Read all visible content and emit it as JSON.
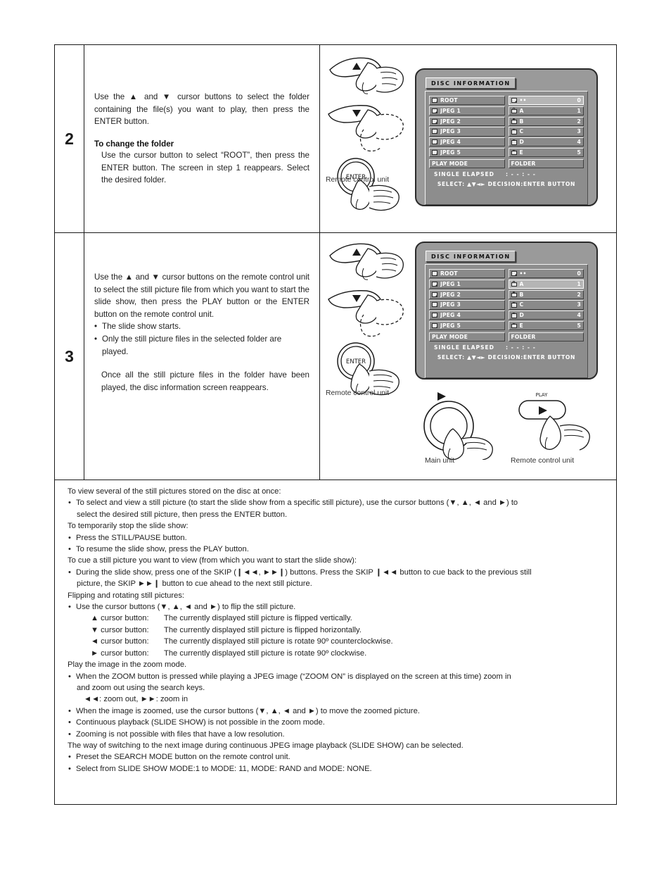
{
  "steps": [
    {
      "number": "2",
      "paragraphs": [
        "Use the ▲ and ▼ cursor buttons to select the folder containing the file(s) you want to play, then press the ENTER button."
      ],
      "subhead": "To change the folder",
      "subtext": "Use the cursor button to select “ROOT”, then press the ENTER button. The screen in step 1 reappears. Select the desired folder.",
      "caption_remote": "Remote control unit"
    },
    {
      "number": "3",
      "paragraphs": [
        "Use the ▲ and ▼ cursor buttons on the remote control unit to select the still picture file from which you want to start the slide show, then press the PLAY button or the ENTER button on the remote control unit."
      ],
      "bullets": [
        "The slide show starts.",
        "Only the still picture files in the selected folder are played."
      ],
      "tail": "Once all the still picture files in the folder have been played, the disc information screen reappears.",
      "caption_remote": "Remote control unit",
      "caption_main": "Main unit",
      "caption_remote2": "Remote control unit",
      "play_label": "PLAY"
    }
  ],
  "osd": {
    "title": "DISC INFORMATION",
    "folders": [
      {
        "icon": "folder-icon",
        "label": "ROOT"
      },
      {
        "icon": "folder-icon",
        "label": "JPEG 1"
      },
      {
        "icon": "folder-icon",
        "label": "JPEG 2"
      },
      {
        "icon": "folder-icon",
        "label": "JPEG 3"
      },
      {
        "icon": "folder-icon",
        "label": "JPEG 4"
      },
      {
        "icon": "folder-icon",
        "label": "JPEG 5"
      }
    ],
    "files": [
      {
        "icon": "folder-icon",
        "label": "••",
        "num": "0"
      },
      {
        "icon": "photo-icon",
        "label": "A",
        "num": "1"
      },
      {
        "icon": "photo-icon",
        "label": "B",
        "num": "2"
      },
      {
        "icon": "photo-icon",
        "label": "C",
        "num": "3"
      },
      {
        "icon": "photo-icon",
        "label": "D",
        "num": "4"
      },
      {
        "icon": "photo-icon",
        "label": "E",
        "num": "5"
      }
    ],
    "selected_index_step2": 0,
    "selected_index_step3": 1,
    "play_mode_label": "PLAY MODE",
    "play_mode_value": "FOLDER",
    "elapsed_label": "SINGLE ELAPSED",
    "elapsed_value": ": - - : - -",
    "select_line": "SELECT: ▲▼◄►  DECISION:ENTER BUTTON"
  },
  "remote_keys": {
    "up": "▲",
    "down": "▼",
    "enter": "ENTER",
    "play_arrow": "►"
  },
  "notes": {
    "l1": "To view several of the still pictures stored on the disc at once:",
    "b1a": "To select and view a still picture (to start the slide show from a specific still picture), use the cursor buttons (▼, ▲, ◄ and ►) to",
    "b1b": "select the desired still picture, then press the ENTER button.",
    "l2": "To temporarily stop the slide show:",
    "b2": "Press the STILL/PAUSE button.",
    "b3": "To resume the slide show, press the PLAY button.",
    "l3": "To cue a still picture you want to view (from which you want to start the slide show):",
    "b4a": "During the slide show, press one of the SKIP (❙◄◄, ►►❙) buttons. Press the SKIP ❙◄◄ button to cue back to the previous still",
    "b4b": "picture, the SKIP ►►❙ button to cue ahead to the next still picture.",
    "l4": "Flipping and rotating still pictures:",
    "b5": "Use the cursor buttons (▼, ▲, ◄ and ►) to flip the still picture.",
    "s1k": "▲ cursor button:",
    "s1v": "The currently displayed still picture is flipped vertically.",
    "s2k": "▼ cursor button:",
    "s2v": "The currently displayed still picture is flipped horizontally.",
    "s3k": "◄ cursor button:",
    "s3v": "The currently displayed still picture is rotate 90º counterclockwise.",
    "s4k": "► cursor button:",
    "s4v": "The currently displayed still picture is rotate 90º clockwise.",
    "l5": "Play the image in the zoom mode.",
    "b6a": "When the ZOOM button is pressed while playing a JPEG image (“ZOOM ON” is displayed on the screen at this time) zoom in",
    "b6b": "and zoom out using the search keys.",
    "b6c": "◄◄: zoom out, ►►: zoom in",
    "b7": "When the image is zoomed, use the cursor buttons (▼, ▲, ◄ and ►) to move the zoomed picture.",
    "b8": "Continuous playback (SLIDE SHOW) is not possible in the zoom mode.",
    "b9": "Zooming is not possible with files that have a low resolution.",
    "l6": "The way of switching to the next image during continuous JPEG image playback (SLIDE SHOW) can be selected.",
    "b10": "Preset the SEARCH MODE button on the remote control unit.",
    "b11": "Select from SLIDE SHOW MODE:1 to MODE: 11, MODE: RAND and MODE: NONE."
  }
}
